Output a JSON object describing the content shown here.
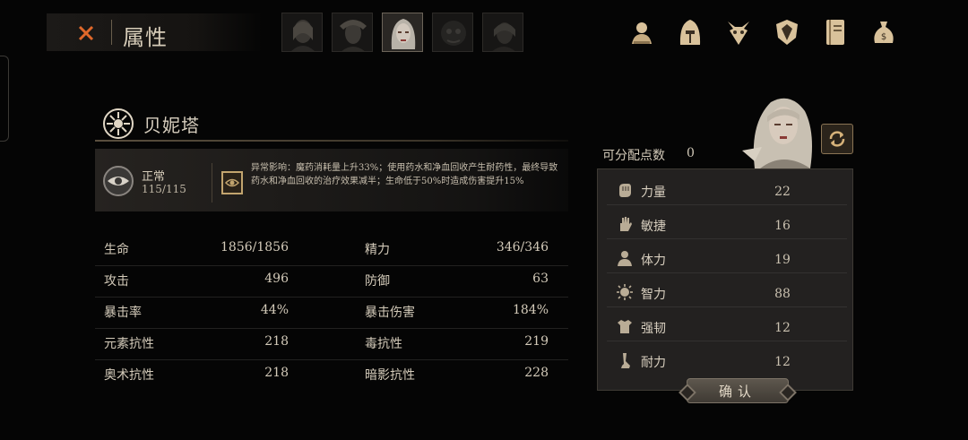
{
  "header": {
    "title": "属性",
    "close_icon": "close-x-icon"
  },
  "party": [
    {
      "name": "portrait-1",
      "active": false
    },
    {
      "name": "portrait-2",
      "active": false
    },
    {
      "name": "portrait-3",
      "active": true
    },
    {
      "name": "portrait-4",
      "active": false
    },
    {
      "name": "portrait-5",
      "active": false
    }
  ],
  "nav_icons": [
    "character-bust-icon",
    "helmet-icon",
    "beast-skull-icon",
    "shield-emblem-icon",
    "journal-icon",
    "money-bag-icon"
  ],
  "character": {
    "name": "贝妮塔",
    "class_icon": "radiant-sun-icon"
  },
  "status": {
    "name": "正常",
    "value": "115/115",
    "effect": "异常影响：魔药消耗量上升33%；使用药水和净血回收产生耐药性，最终导致药水和净血回收的治疗效果减半；生命低于50%时造成伤害提升15%"
  },
  "stats": [
    {
      "label": "生命",
      "value": "1856/1856",
      "label2": "精力",
      "value2": "346/346"
    },
    {
      "label": "攻击",
      "value": "496",
      "label2": "防御",
      "value2": "63"
    },
    {
      "label": "暴击率",
      "value": "44%",
      "label2": "暴击伤害",
      "value2": "184%"
    },
    {
      "label": "元素抗性",
      "value": "218",
      "label2": "毒抗性",
      "value2": "219"
    },
    {
      "label": "奥术抗性",
      "value": "218",
      "label2": "暗影抗性",
      "value2": "228"
    }
  ],
  "allocation": {
    "label": "可分配点数",
    "points": "0"
  },
  "attributes": [
    {
      "name": "力量",
      "value": "22",
      "icon": "fist-icon"
    },
    {
      "name": "敏捷",
      "value": "16",
      "icon": "hand-icon"
    },
    {
      "name": "体力",
      "value": "19",
      "icon": "person-icon"
    },
    {
      "name": "智力",
      "value": "88",
      "icon": "brain-burst-icon"
    },
    {
      "name": "强韧",
      "value": "12",
      "icon": "armor-icon"
    },
    {
      "name": "耐力",
      "value": "12",
      "icon": "leg-icon"
    }
  ],
  "confirm_label": "确认"
}
